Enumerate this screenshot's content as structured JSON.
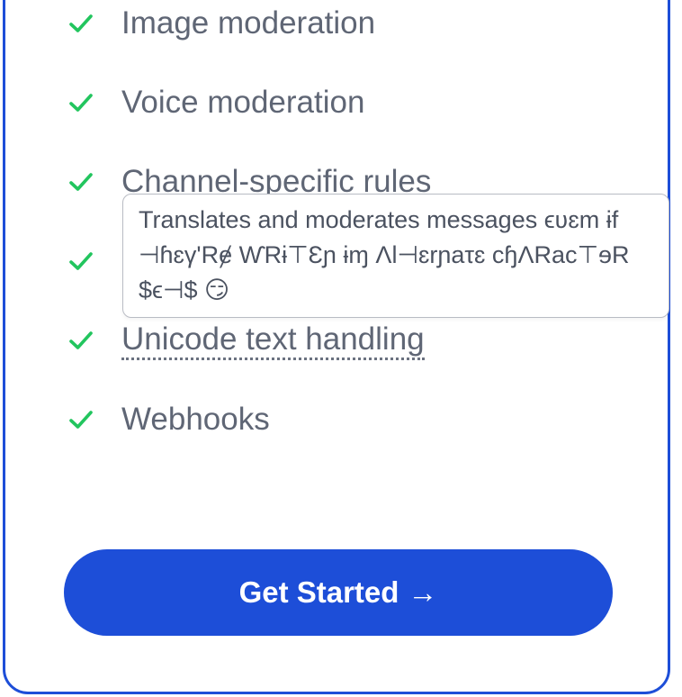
{
  "features": [
    {
      "label": "Image moderation"
    },
    {
      "label": "Voice moderation"
    },
    {
      "label": "Channel-specific rules"
    },
    {
      "label": ""
    },
    {
      "label": "Unicode text handling"
    },
    {
      "label": "Webhooks"
    }
  ],
  "tooltip": {
    "text": "Translates and moderates messages ϵʋɛm ɨf ⊣ɦɛγ'Rɇ ⱲRɨ⊤Ɛɲ ɨɱ ɅƖ⊣ɛrɲaτɛ ϲɧɅRaϲ⊤ɘR $ϵ⊣$ 😏"
  },
  "cta": {
    "label": "Get Started",
    "arrow": "→"
  },
  "colors": {
    "accent": "#1d4ed8",
    "check": "#22c55e",
    "text": "#5f6675"
  },
  "icons": {
    "check": "check-icon",
    "arrow": "arrow-right-icon"
  }
}
